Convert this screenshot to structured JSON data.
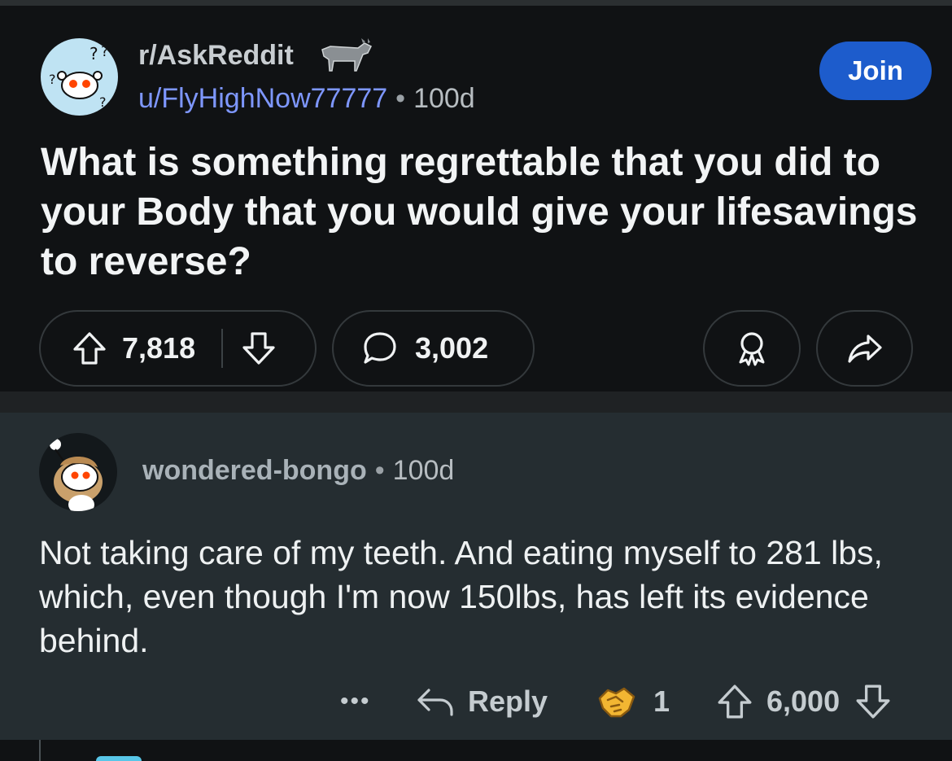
{
  "post": {
    "subreddit": "r/AskReddit",
    "author": "u/FlyHighNow77777",
    "separator": "•",
    "age": "100d",
    "join_label": "Join",
    "title": "What is something regrettable that you did to your Body that you would give your lifesavings to reverse?",
    "upvotes": "7,818",
    "comments": "3,002"
  },
  "comment": {
    "author": "wondered-bongo",
    "separator": "•",
    "age": "100d",
    "body": "Not taking care of my teeth. And eating myself to 281 lbs, which, even though I'm now 150lbs, has left its evidence behind.",
    "more_label": "•••",
    "reply_label": "Reply",
    "award_count": "1",
    "score": "6,000"
  },
  "colors": {
    "join_button": "#1d5ccc",
    "username_link": "#7e97ff",
    "post_bg": "#101214",
    "comment_bg": "#252d31"
  },
  "icons": [
    "snoo-avatar-icon",
    "donkey-icon",
    "upvote-icon",
    "downvote-icon",
    "comment-icon",
    "award-icon",
    "share-icon",
    "reply-icon",
    "handshake-award-icon"
  ]
}
